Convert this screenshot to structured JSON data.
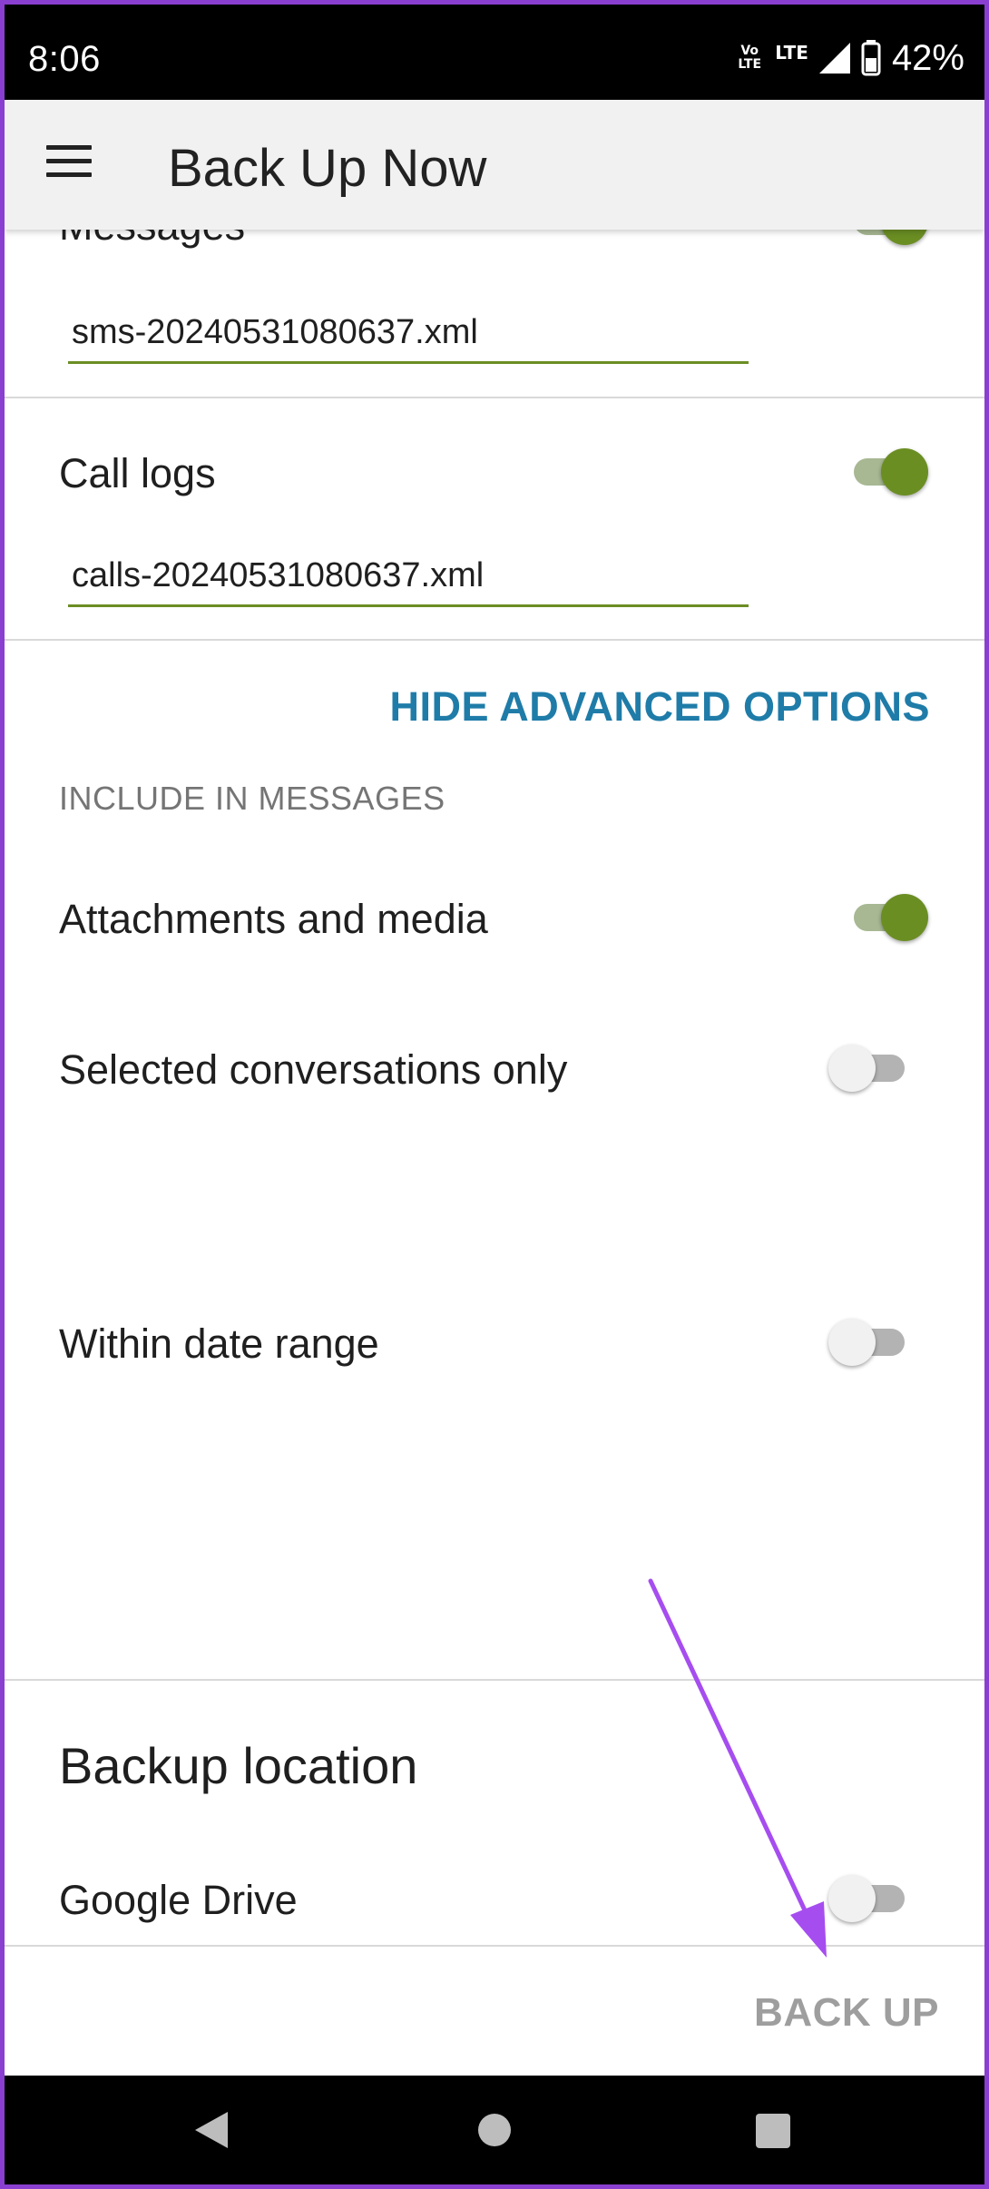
{
  "status_bar": {
    "time": "8:06",
    "volte": "Vo\nLTE",
    "lte": "LTE",
    "battery": "42%"
  },
  "app_bar": {
    "title": "Back Up Now"
  },
  "messages": {
    "label": "Messages",
    "toggle_on": true,
    "filename": "sms-20240531080637.xml"
  },
  "call_logs": {
    "label": "Call logs",
    "toggle_on": true,
    "filename": "calls-20240531080637.xml"
  },
  "advanced": {
    "hide_label": "HIDE ADVANCED OPTIONS",
    "include_header": "INCLUDE IN MESSAGES",
    "attachments_label": "Attachments and media",
    "attachments_on": true,
    "selected_conversations_label": "Selected conversations only",
    "selected_conversations_on": false,
    "date_range_label": "Within date range",
    "date_range_on": false
  },
  "backup_location": {
    "title": "Backup location",
    "google_drive_label": "Google Drive",
    "google_drive_on": false
  },
  "actions": {
    "back_up_label": "BACK UP"
  },
  "colors": {
    "accent_green": "#6b8e23",
    "link_blue": "#1f7ca8",
    "annotation_purple": "#a64df0",
    "frame_border": "#8a3fd0"
  },
  "icons": {
    "menu": "hamburger-menu-icon",
    "signal": "signal-icon",
    "battery": "battery-icon",
    "nav_back": "back-triangle-icon",
    "nav_home": "home-circle-icon",
    "nav_recent": "recent-square-icon"
  }
}
